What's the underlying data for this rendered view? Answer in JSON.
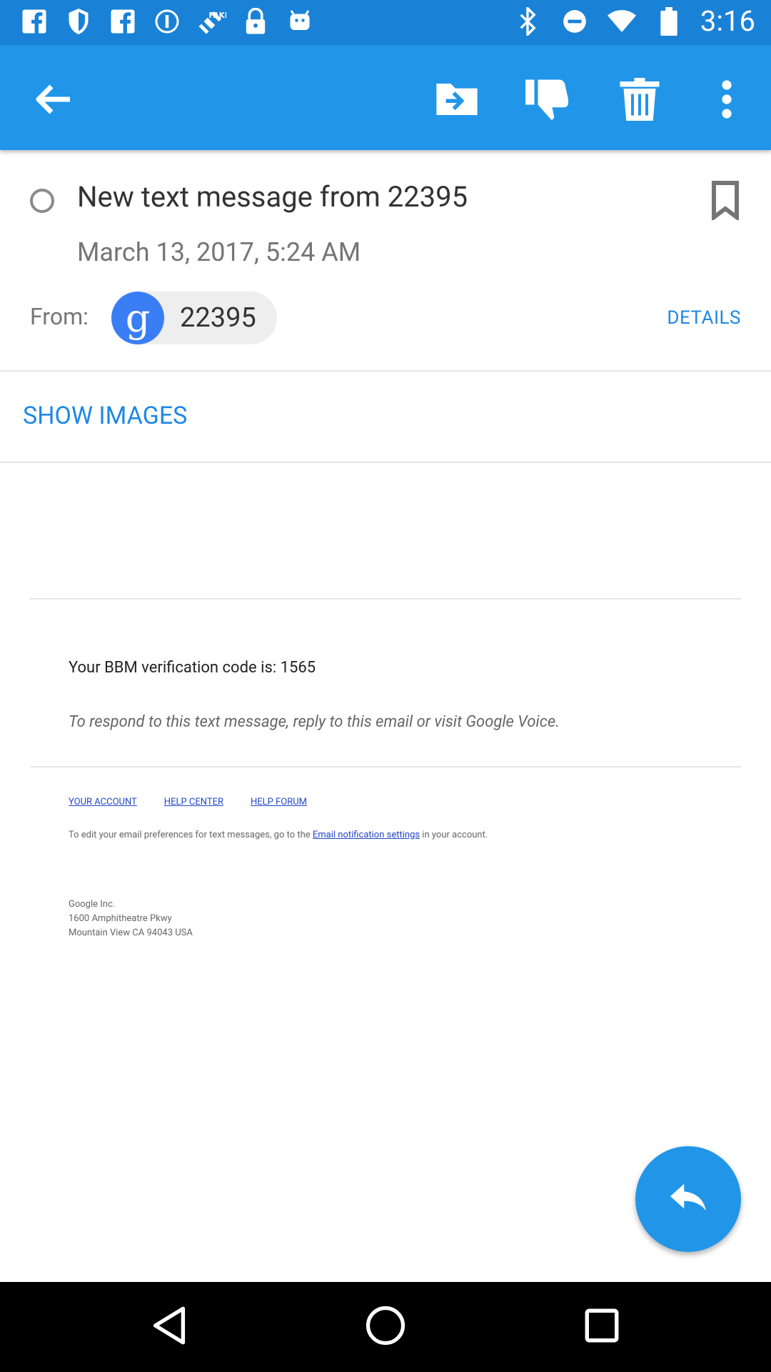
{
  "status_bar": {
    "time": "3:16",
    "left_icons": [
      "facebook-icon",
      "shield-icon",
      "facebook-icon",
      "info-icon",
      "fake-gps-icon",
      "lock-icon",
      "android-icon"
    ],
    "right_icons": [
      "bluetooth-icon",
      "do-not-disturb-icon",
      "wifi-icon",
      "battery-icon"
    ]
  },
  "app_bar": {
    "actions": [
      "back-arrow-icon",
      "move-to-icon",
      "thumbs-down-icon",
      "delete-icon",
      "more-vert-icon"
    ],
    "color": "#2196e9"
  },
  "message": {
    "subject": "New text message from 22395",
    "date": "March 13, 2017, 5:24 AM",
    "from_label": "From:",
    "sender_initial": "g",
    "sender": "22395",
    "details_label": "DETAILS"
  },
  "show_images_label": "SHOW IMAGES",
  "body": {
    "code_line": "Your BBM verification code is: 1565",
    "respond_line": "To respond to this text message, reply to this email or visit Google Voice.",
    "links": [
      "YOUR ACCOUNT",
      "HELP CENTER",
      "HELP FORUM"
    ],
    "prefs_prefix": "To edit your email preferences for text messages, go to the ",
    "prefs_link": "Email notification settings",
    "prefs_suffix": " in your account.",
    "address": [
      "Google Inc.",
      "1600 Amphitheatre Pkwy",
      "Mountain View CA 94043 USA"
    ]
  },
  "fab": {
    "icon": "reply-icon"
  },
  "nav_bar": [
    "back-nav-icon",
    "home-nav-icon",
    "recents-nav-icon"
  ]
}
